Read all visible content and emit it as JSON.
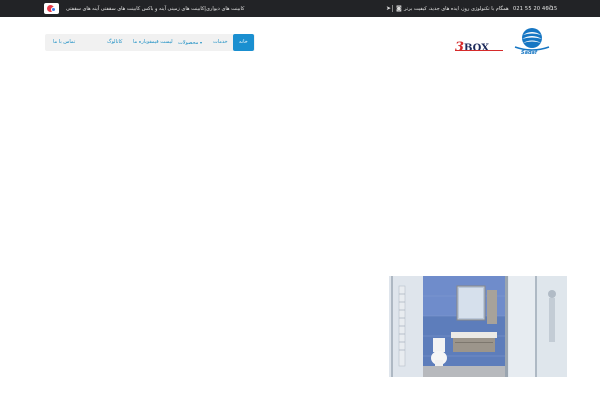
{
  "topbar": {
    "links_text": "کابینت های دیواری|کابینت های زمینی   آینه و باکس   کابینت های سقفتی   آینه های سقفتی",
    "tagline": "همگام با تکنولوژی روز، ایده های جدید، کیفیت برتر",
    "phone": "021 55 20 46 15",
    "icons": [
      "phone-icon",
      "instagram-icon",
      "telegram-icon"
    ]
  },
  "nav": {
    "items": [
      {
        "label": "خانه",
        "active": true
      },
      {
        "label": "خدمات"
      },
      {
        "label": "محصولات",
        "has_dropdown": true
      },
      {
        "label": "لیست قیمت"
      },
      {
        "label": "کاتالوگ"
      },
      {
        "label": "درباره ما"
      },
      {
        "label": "تماس با ما"
      }
    ]
  },
  "logos": {
    "box_number": "3",
    "box_word": "BOX",
    "sadaf_word": "Sadaf"
  },
  "colors": {
    "topbar_bg": "#222326",
    "nav_active": "#1a8fd0",
    "nav_text": "#1c8fc4",
    "brand_red": "#d62b2b"
  }
}
